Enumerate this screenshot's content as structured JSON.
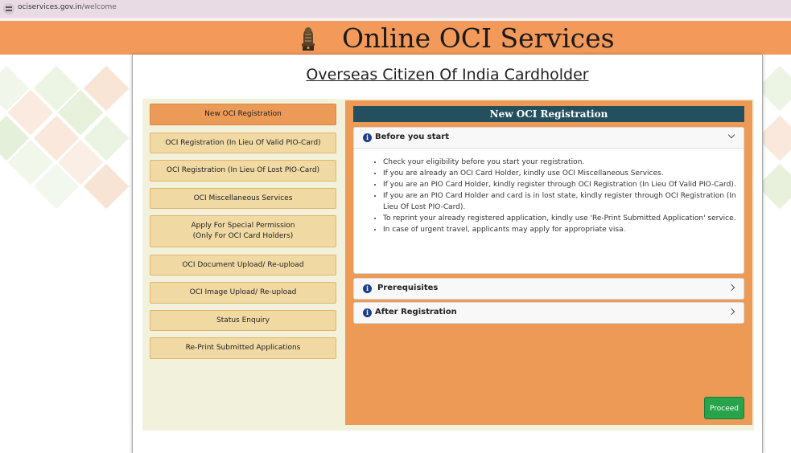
{
  "browser": {
    "domain": "ociservices.gov.in",
    "path": "/welcome"
  },
  "header": {
    "title": "Online OCI Services",
    "emblem_icon": "national-emblem-icon"
  },
  "page": {
    "heading": "Overseas Citizen Of India Cardholder"
  },
  "menu": {
    "items": [
      {
        "label": "New OCI Registration",
        "active": true
      },
      {
        "label": "OCI Registration (In Lieu Of Valid PIO-Card)",
        "active": false
      },
      {
        "label": "OCI Registration (In Lieu Of Lost PIO-Card)",
        "active": false
      },
      {
        "label": "OCI Miscellaneous Services",
        "active": false
      },
      {
        "label": "Apply For Special Permission",
        "label2": "(Only For OCI Card Holders)",
        "active": false
      },
      {
        "label": "OCI Document Upload/ Re-upload",
        "active": false
      },
      {
        "label": "OCI Image Upload/ Re-upload",
        "active": false
      },
      {
        "label": "Status Enquiry",
        "active": false
      },
      {
        "label": "Re-Print Submitted Applications",
        "active": false
      }
    ]
  },
  "content": {
    "title": "New OCI Registration",
    "sections": [
      {
        "title": "Before you start",
        "expanded": true,
        "items": [
          "Check your eligibility before you start your registration.",
          "If you are already an OCI Card Holder, kindly use OCI Miscellaneous Services.",
          "If you are an PIO Card Holder, kindly register through OCI Registration (In Lieu Of Valid PIO-Card).",
          "If you are an PIO Card Holder and card is in lost state, kindly register through OCI Registration (In Lieu Of Lost PIO-Card).",
          "To reprint your already registered application, kindly use 'Re-Print Submitted Application' service.",
          "In case of urgent travel, applicants may apply for appropriate visa."
        ]
      },
      {
        "title": "Prerequisites",
        "expanded": false
      },
      {
        "title": "After Registration",
        "expanded": false
      }
    ],
    "proceed_label": "Proceed"
  },
  "colors": {
    "header_bg": "#f39a5b",
    "content_bg": "#ec9a55",
    "content_title_bg": "#244f5c",
    "menu_btn": "#f1d9a3",
    "menu_btn_active": "#ec9a57",
    "proceed": "#27a34b"
  }
}
